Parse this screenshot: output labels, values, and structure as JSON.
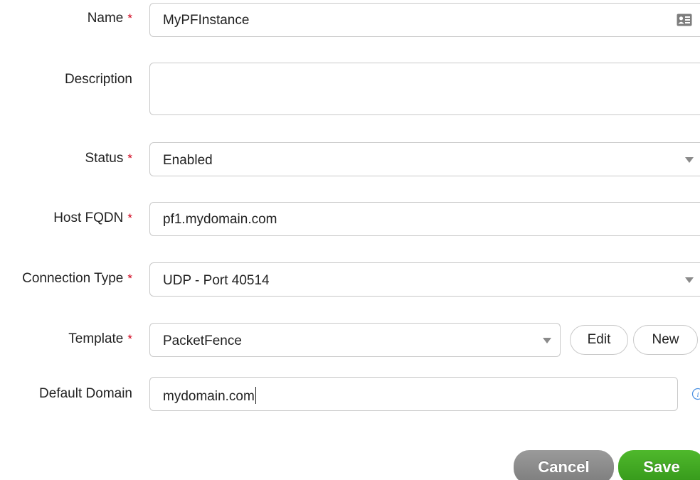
{
  "fields": {
    "name": {
      "label": "Name",
      "required": "*",
      "value": "MyPFInstance"
    },
    "description": {
      "label": "Description",
      "value": ""
    },
    "status": {
      "label": "Status",
      "required": "*",
      "value": "Enabled"
    },
    "host_fqdn": {
      "label": "Host FQDN",
      "required": "*",
      "value": "pf1.mydomain.com"
    },
    "connection_type": {
      "label": "Connection Type",
      "required": "*",
      "value": "UDP - Port 40514"
    },
    "template": {
      "label": "Template",
      "required": "*",
      "value": "PacketFence",
      "edit_label": "Edit",
      "new_label": "New"
    },
    "default_domain": {
      "label": "Default Domain",
      "value": "mydomain.com"
    }
  },
  "actions": {
    "cancel_label": "Cancel",
    "save_label": "Save"
  },
  "colors": {
    "required": "#d0021b",
    "cancel": "#8c8c8c",
    "save": "#3ea51f",
    "info": "#4a90e2"
  },
  "icons": {
    "name_field": "contact-card-icon",
    "dropdown": "triangle-down-icon",
    "info": "info-icon"
  }
}
